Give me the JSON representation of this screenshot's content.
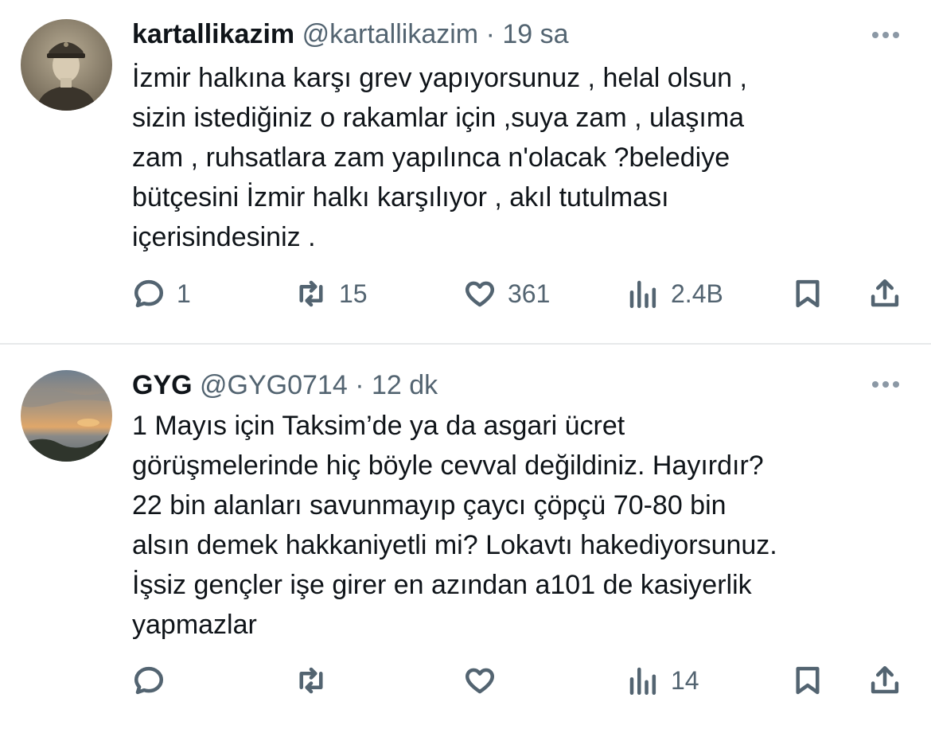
{
  "tweets": [
    {
      "name": "kartallikazim",
      "handle": "@kartallikazim",
      "dot": "·",
      "time": "19 sa",
      "lines": [
        "İzmir halkına karşı grev yapıyorsunuz , helal olsun ,",
        "sizin istediğiniz o rakamlar için ,suya zam , ulaşıma",
        "zam , ruhsatlara zam yapılınca n'olacak ?belediye",
        "bütçesini İzmir halkı karşılıyor , akıl tutulması",
        "içerisindesiniz ."
      ],
      "replies": "1",
      "retweets": "15",
      "likes": "361",
      "views": "2.4B"
    },
    {
      "name": "GYG",
      "handle": "@GYG0714",
      "dot": "·",
      "time": "12 dk",
      "lines": [
        "1 Mayıs için Taksim’de ya da asgari ücret",
        "görüşmelerinde hiç böyle cevval değildiniz. Hayırdır?",
        "22 bin alanları savunmayıp çaycı çöpçü 70-80 bin",
        "alsın demek hakkaniyetli mi? Lokavtı hakediyorsunuz.",
        "İşsiz gençler işe girer en azından a101 de kasiyerlik",
        "yapmazlar"
      ],
      "replies": "",
      "retweets": "",
      "likes": "",
      "views": "14"
    }
  ],
  "icons": {
    "reply": "reply-icon",
    "retweet": "retweet-icon",
    "like": "heart-icon",
    "views": "views-icon",
    "bookmark": "bookmark-icon",
    "share": "share-icon",
    "more": "more-icon"
  },
  "colors": {
    "text": "#0f1419",
    "secondary": "#536471",
    "divider": "#e7e9ea"
  }
}
